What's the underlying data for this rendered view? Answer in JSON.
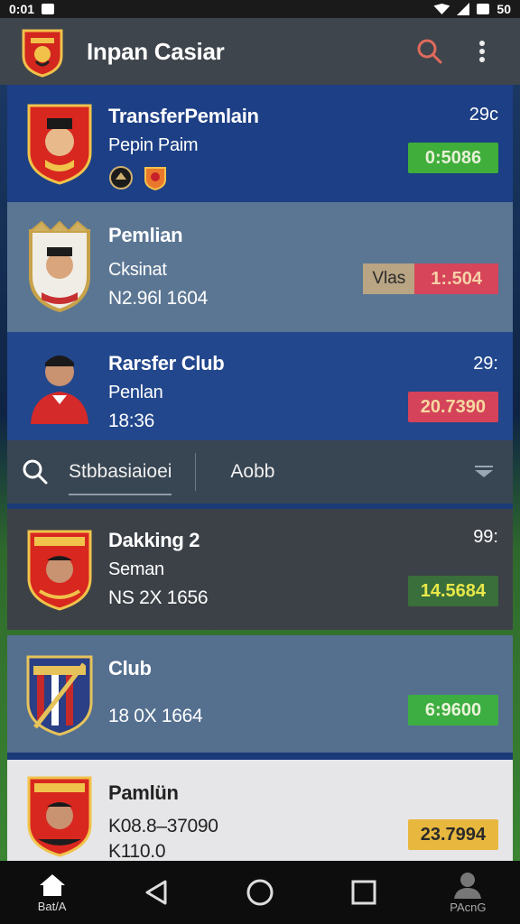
{
  "status_bar": {
    "time": "0:01",
    "battery": "50"
  },
  "app_bar": {
    "title": "Inpan Casiar"
  },
  "cards": [
    {
      "name": "TransferPemlain",
      "sub": "Pepin Paim",
      "corner": "29c",
      "value": "0:5086",
      "value_color": "#3fae3a"
    },
    {
      "name": "Pemlian",
      "sub": "Cksinat",
      "meta": "N2.96l 1604",
      "tag": "Vlas",
      "value": "1:.504",
      "value_color": "#d6455a"
    },
    {
      "name": "Rarsfer Club",
      "sub": "Penlan",
      "meta": "18:36",
      "corner": "29:",
      "value": "20.7390",
      "value_color": "#d4435a"
    },
    {
      "name": "Dakking 2",
      "sub": "Seman",
      "meta": "NS 2X 1656",
      "corner": "99:",
      "value": "14.5684",
      "value_color": "#3a6e3a"
    },
    {
      "name": "Club",
      "meta": "18 0X 1664",
      "value": "6:9600",
      "value_color": "#3dae42"
    },
    {
      "name": "Pamlün",
      "meta": "K08.8–37090",
      "meta2": "K110.0",
      "value": "23.7994",
      "value_color": "#e8b83e"
    }
  ],
  "search_bar": {
    "tab_active": "Stbbasiaioei",
    "tab_other": "Aobb"
  },
  "nav": {
    "home_label": "Bat/A",
    "profile_label": "PAcnG"
  }
}
